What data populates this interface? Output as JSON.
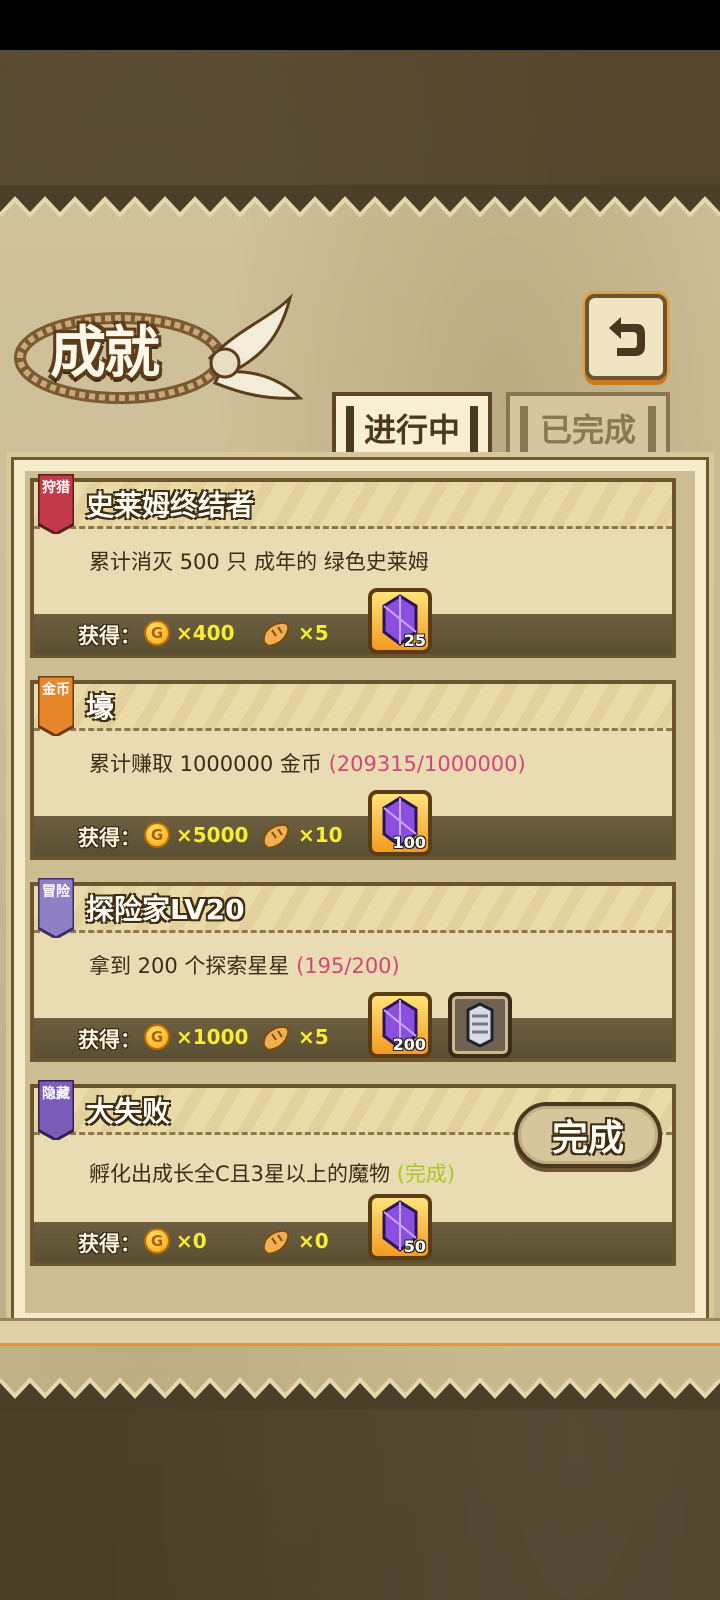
{
  "header": {
    "title": "成就"
  },
  "tabs": [
    {
      "label": "进行中",
      "active": true
    },
    {
      "label": "已完成",
      "active": false
    }
  ],
  "reward_prefix": "获得：",
  "coin_letter": "G",
  "cards": [
    {
      "badge": "狩猎",
      "title": "史莱姆终结者",
      "description": "累计消灭 500 只 成年的 绿色史莱姆",
      "progress": "",
      "coins": "×400",
      "bread": "×5",
      "gem": "25"
    },
    {
      "badge": "金币",
      "title": "壕",
      "description": "累计赚取 1000000 金币 ",
      "progress": "(209315/1000000)",
      "coins": "×5000",
      "bread": "×10",
      "gem": "100"
    },
    {
      "badge": "冒险",
      "title": "探险家LV20",
      "description": "拿到 200 个探索星星 ",
      "progress": "(195/200)",
      "coins": "×1000",
      "bread": "×5",
      "gem": "200"
    },
    {
      "badge": "隐藏",
      "title": "大失败",
      "description": "孵化出成长全C且3星以上的魔物 ",
      "status": "(完成)",
      "coins": "×0",
      "bread": "×0",
      "gem": "50",
      "button": "完成"
    }
  ],
  "colors": {
    "accent_orange": "#f28f2c",
    "progress_pink": "#d4457a",
    "done_green": "#a7c82a",
    "reward_yellow": "#f7ee34",
    "badge_red": "#c23a4a",
    "badge_orange": "#e8862c",
    "badge_purple": "#7b5cb8"
  }
}
